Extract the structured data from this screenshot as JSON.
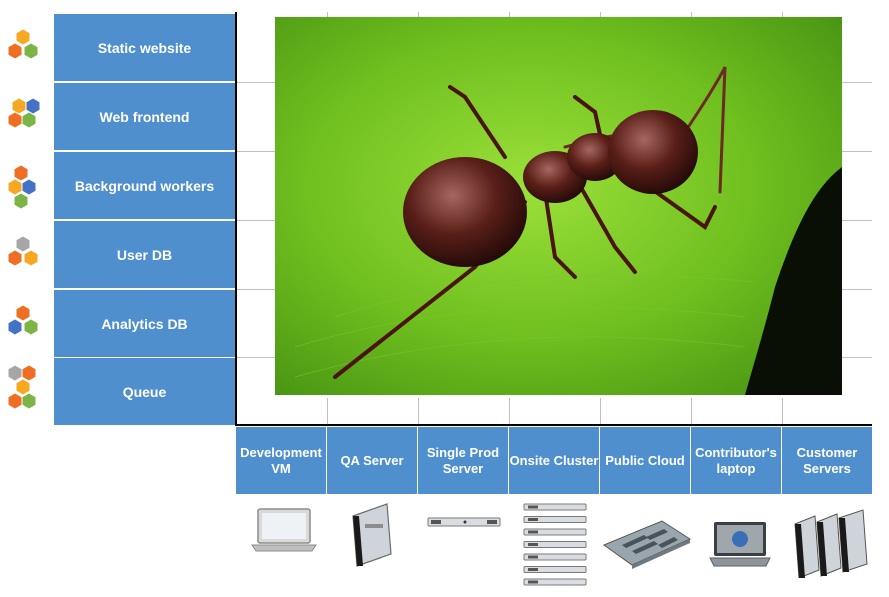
{
  "rows": [
    {
      "label": "Static website",
      "hex_colors": [
        "#f7a823",
        "#ee6f24",
        "#7cb445"
      ]
    },
    {
      "label": "Web frontend",
      "hex_colors": [
        "#f7a823",
        "#4472c4",
        "#ee6f24",
        "#7cb445"
      ]
    },
    {
      "label": "Background workers",
      "hex_colors": [
        "#ee6f24",
        "#f7a823",
        "#4472c4",
        "#7cb445"
      ]
    },
    {
      "label": "User DB",
      "hex_colors": [
        "#a6a6a6",
        "#ee6f24",
        "#f7a823"
      ]
    },
    {
      "label": "Analytics  DB",
      "hex_colors": [
        "#ee6f24",
        "#4472c4",
        "#7cb445"
      ]
    },
    {
      "label": "Queue",
      "hex_colors": [
        "#a6a6a6",
        "#ee6f24",
        "#f7a823",
        "#ee6f24",
        "#7cb445"
      ]
    }
  ],
  "columns": [
    {
      "label": "Development VM",
      "device": "laptop-icon"
    },
    {
      "label": "QA  Server",
      "device": "blade-server-icon"
    },
    {
      "label": "Single Prod Server",
      "device": "rack-server-icon"
    },
    {
      "label": "Onsite Cluster",
      "device": "server-stack-icon"
    },
    {
      "label": "Public Cloud",
      "device": "motherboard-icon"
    },
    {
      "label": "Contributor's laptop",
      "device": "dell-laptop-icon"
    },
    {
      "label": "Customer Servers",
      "device": "blade-servers-icon"
    }
  ],
  "photo": {
    "subject": "ant-on-leaf",
    "colors": {
      "leaf": "#6fbf1f",
      "ant": "#5a1f18"
    }
  },
  "colors": {
    "label_bg": "#4f8fce",
    "label_text": "#ffffff",
    "axis": "#000000"
  }
}
